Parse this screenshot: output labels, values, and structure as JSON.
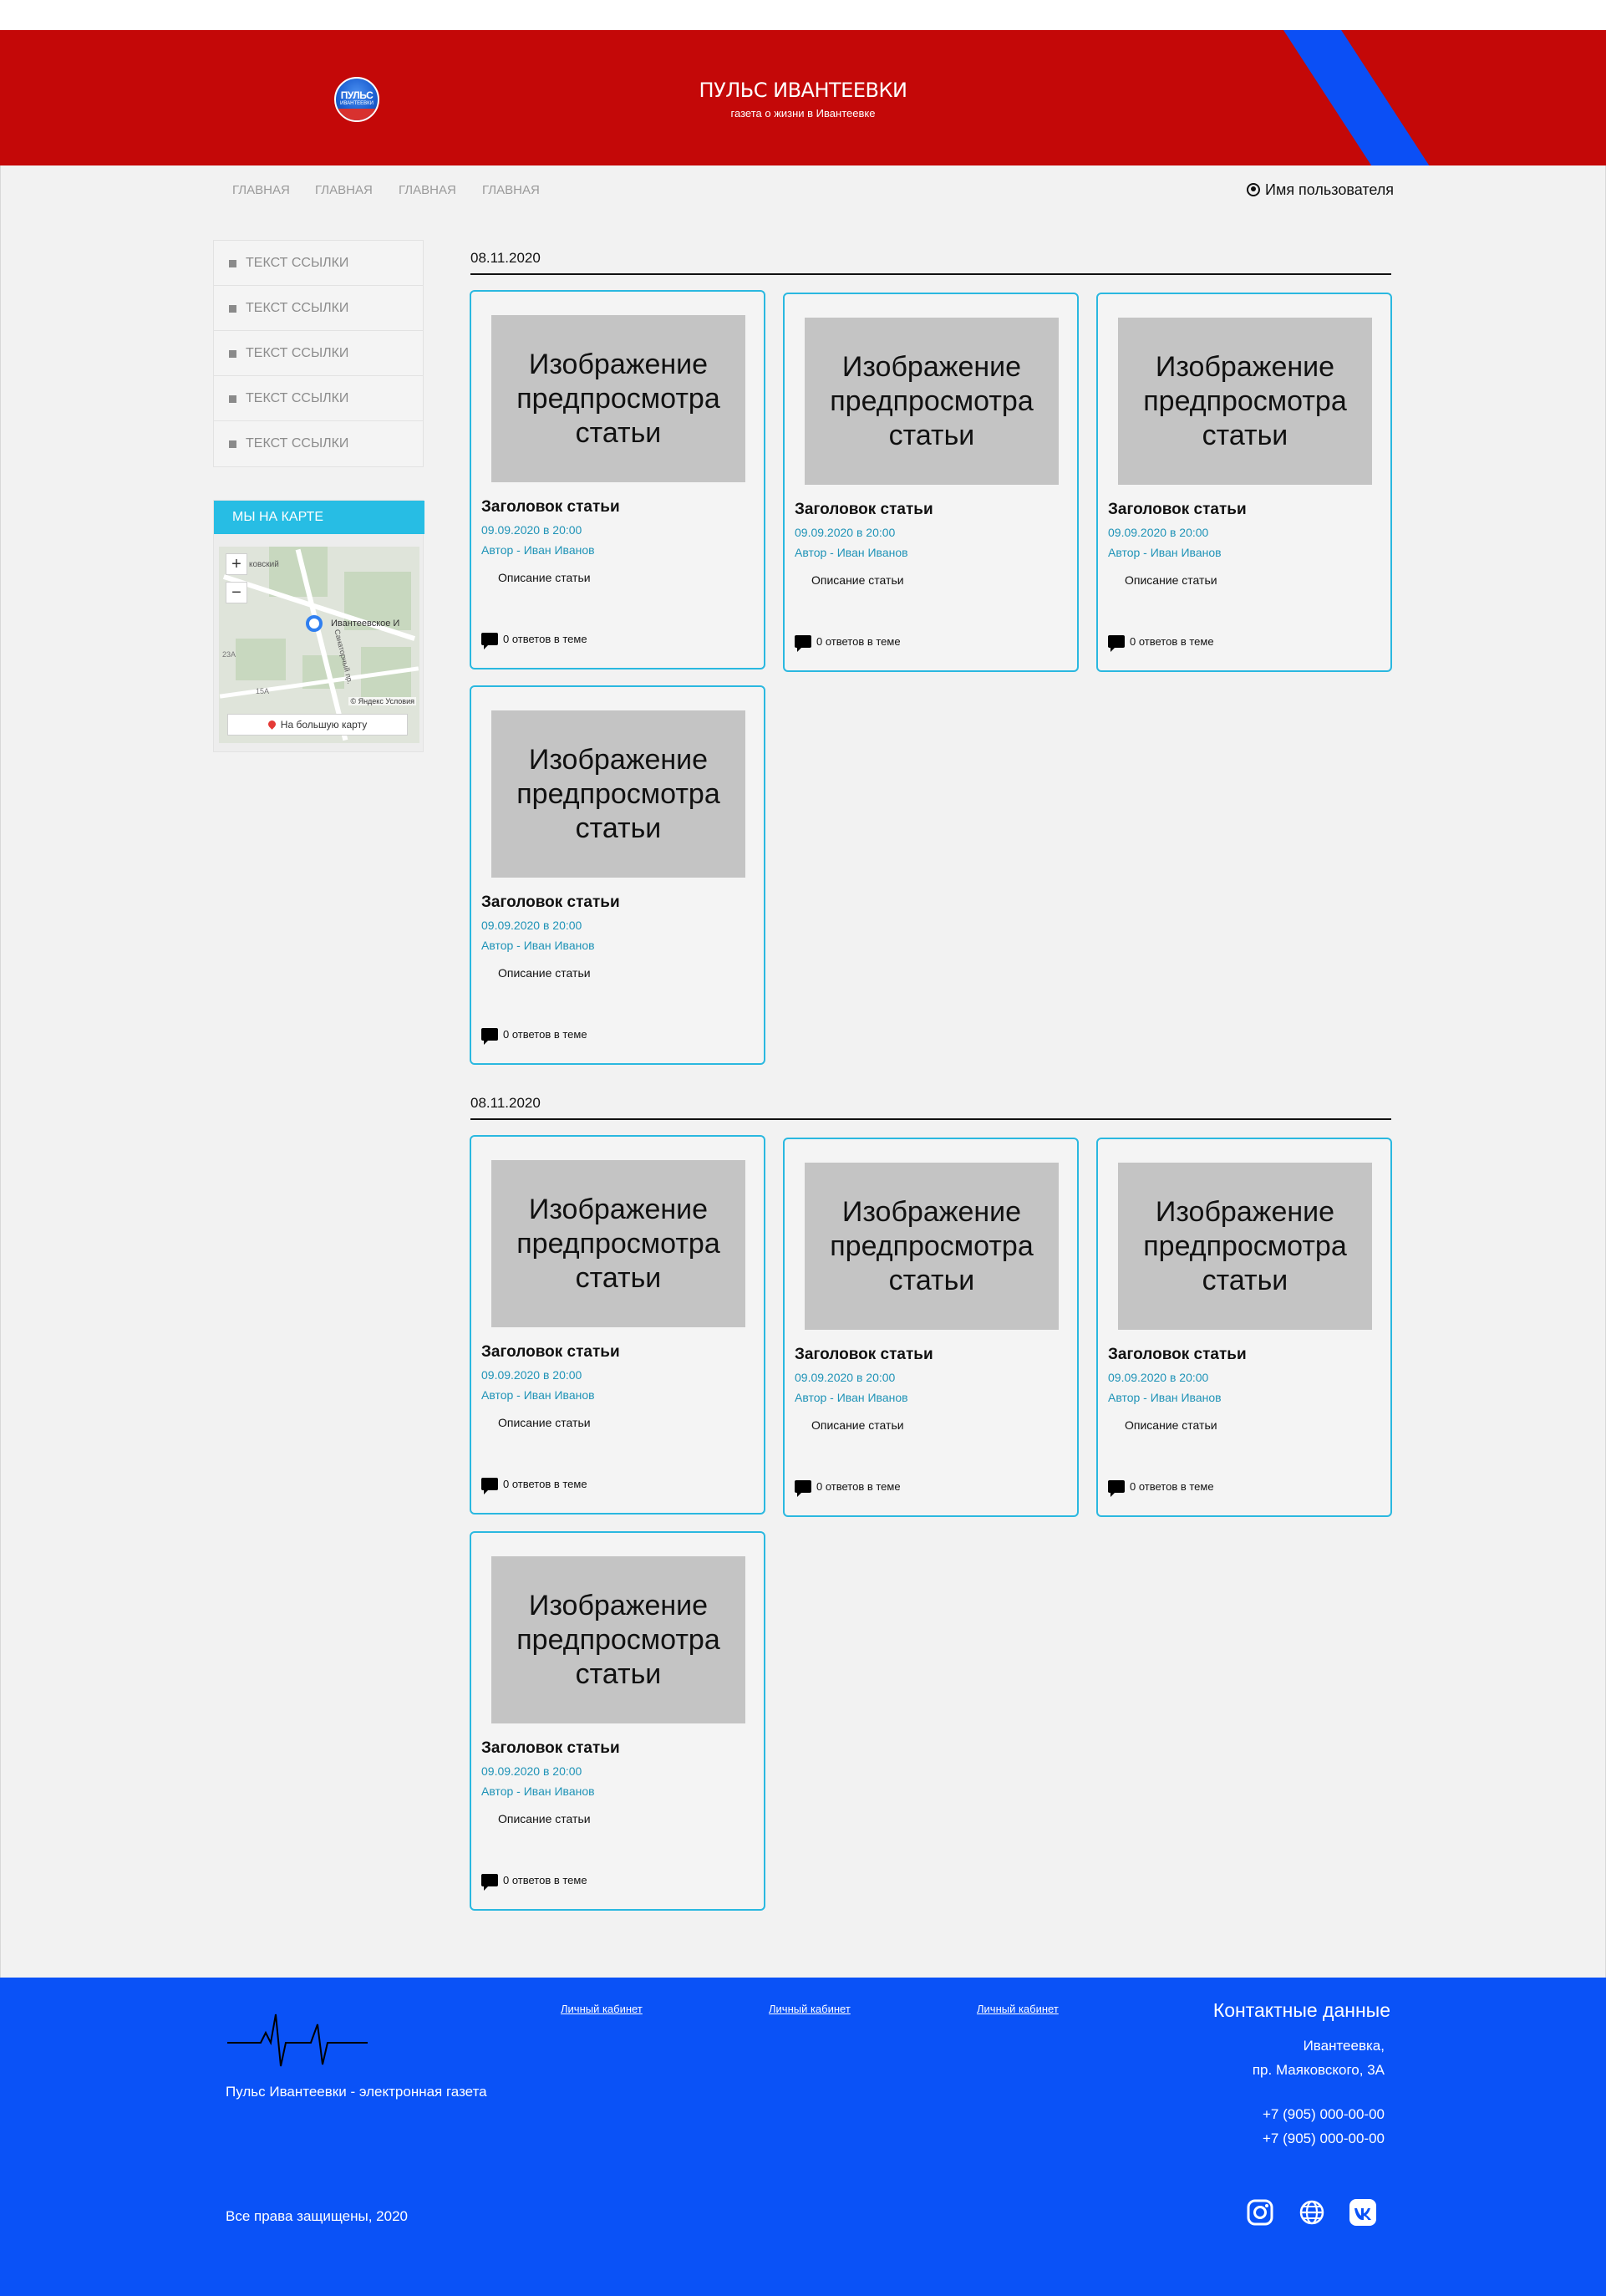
{
  "header": {
    "logo_text": "ПУЛЬС",
    "logo_sub": "ИВАНТЕЕВКИ",
    "title": "ПУЛЬС ИВАНТЕЕВКИ",
    "subtitle": "газета о жизни в Ивантеевке",
    "colors": {
      "header_bg": "#c40808",
      "stripe": "#0b4ff5"
    }
  },
  "nav": {
    "items": [
      {
        "label": "ГЛАВНАЯ"
      },
      {
        "label": "ГЛАВНАЯ"
      },
      {
        "label": "ГЛАВНАЯ"
      },
      {
        "label": "ГЛАВНАЯ"
      }
    ],
    "user": {
      "icon": "user-circle-icon",
      "label": "Имя пользователя"
    }
  },
  "sidebar": {
    "links": [
      {
        "label": "ТЕКСТ ССЫЛКИ"
      },
      {
        "label": "ТЕКСТ ССЫЛКИ"
      },
      {
        "label": "ТЕКСТ ССЫЛКИ"
      },
      {
        "label": "ТЕКСТ ССЫЛКИ"
      },
      {
        "label": "ТЕКСТ ССЫЛКИ"
      }
    ],
    "map": {
      "title": "МЫ НА КАРТЕ",
      "zoom_in": "+",
      "zoom_out": "−",
      "place_label": "Ивантеевское И",
      "copyright": "© Яндекс Условия",
      "big_map": "На большую карту",
      "street_labels": [
        "ковский",
        "Санаторный пр.",
        "23А",
        "15А"
      ],
      "colors": {
        "header_bg": "#27bde4"
      }
    }
  },
  "groups": [
    {
      "date": "08.11.2020",
      "articles": [
        {
          "image_text": "Изображение\nпредпросмотра\nстатьи",
          "title": "Заголовок статьи",
          "datetime": "09.09.2020 в 20:00",
          "author": "Автор - Иван Иванов",
          "description": "Описание статьи",
          "replies": "0 ответов в теме"
        },
        {
          "image_text": "Изображение\nпредпросмотра\nстатьи",
          "title": "Заголовок статьи",
          "datetime": "09.09.2020 в 20:00",
          "author": "Автор - Иван Иванов",
          "description": "Описание статьи",
          "replies": "0 ответов в теме"
        },
        {
          "image_text": "Изображение\nпредпросмотра\nстатьи",
          "title": "Заголовок статьи",
          "datetime": "09.09.2020 в 20:00",
          "author": "Автор - Иван Иванов",
          "description": "Описание статьи",
          "replies": "0 ответов в теме"
        },
        {
          "image_text": "Изображение\nпредпросмотра\nстатьи",
          "title": "Заголовок статьи",
          "datetime": "09.09.2020 в 20:00",
          "author": "Автор - Иван Иванов",
          "description": "Описание статьи",
          "replies": "0 ответов в теме"
        }
      ]
    },
    {
      "date": "08.11.2020",
      "articles": [
        {
          "image_text": "Изображение\nпредпросмотра\nстатьи",
          "title": "Заголовок статьи",
          "datetime": "09.09.2020 в 20:00",
          "author": "Автор - Иван Иванов",
          "description": "Описание статьи",
          "replies": "0 ответов в теме"
        },
        {
          "image_text": "Изображение\nпредпросмотра\nстатьи",
          "title": "Заголовок статьи",
          "datetime": "09.09.2020 в 20:00",
          "author": "Автор - Иван Иванов",
          "description": "Описание статьи",
          "replies": "0 ответов в теме"
        },
        {
          "image_text": "Изображение\nпредпросмотра\nстатьи",
          "title": "Заголовок статьи",
          "datetime": "09.09.2020 в 20:00",
          "author": "Автор - Иван Иванов",
          "description": "Описание статьи",
          "replies": "0 ответов в теме"
        },
        {
          "image_text": "Изображение\nпредпросмотра\nстатьи",
          "title": "Заголовок статьи",
          "datetime": "09.09.2020 в 20:00",
          "author": "Автор - Иван Иванов",
          "description": "Описание статьи",
          "replies": "0 ответов в теме"
        }
      ]
    }
  ],
  "footer": {
    "tagline": "Пульс Ивантеевки - электронная газета",
    "links": [
      {
        "label": "Личный кабинет"
      },
      {
        "label": "Личный кабинет"
      },
      {
        "label": "Личный кабинет"
      }
    ],
    "contacts": {
      "title": "Контактные данные",
      "city": "Ивантеевка,",
      "street": "пр. Маяковского, 3А",
      "phone1": "+7 (905) 000-00-00",
      "phone2": "+7 (905) 000-00-00"
    },
    "rights": "Все права защищены, 2020",
    "social": [
      "instagram-icon",
      "globe-icon",
      "vk-icon"
    ],
    "colors": {
      "footer_bg": "#0a52f7"
    }
  }
}
